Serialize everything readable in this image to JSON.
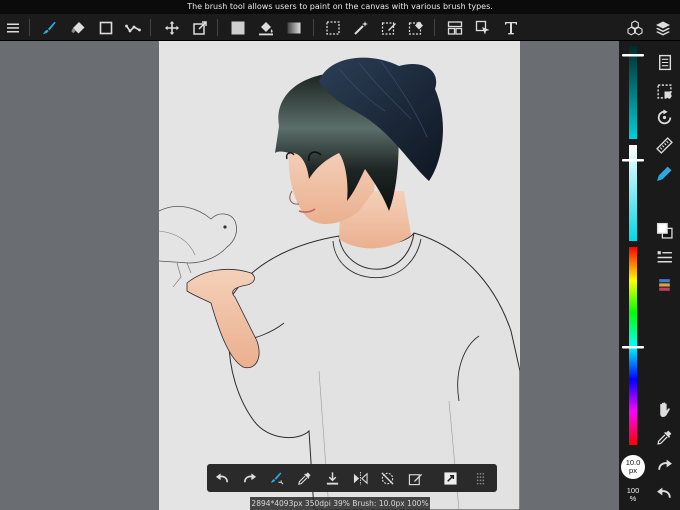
{
  "tooltip": "The brush tool allows users to paint on the canvas with various brush types.",
  "toolbar": {
    "items": [
      {
        "name": "menu-icon"
      },
      {
        "name": "brush-icon",
        "active": true
      },
      {
        "name": "eraser-icon"
      },
      {
        "name": "shape-icon"
      },
      {
        "name": "smudge-icon"
      },
      {
        "name": "move-icon"
      },
      {
        "name": "transform-icon"
      },
      {
        "name": "fill-color-icon"
      },
      {
        "name": "bucket-icon"
      },
      {
        "name": "gradient-icon"
      },
      {
        "name": "select-rect-icon"
      },
      {
        "name": "magic-wand-icon"
      },
      {
        "name": "select-pen-icon"
      },
      {
        "name": "select-eraser-icon"
      },
      {
        "name": "frame-divider-icon"
      },
      {
        "name": "selection-arrow-icon"
      },
      {
        "name": "text-icon"
      },
      {
        "name": "materials-icon"
      },
      {
        "name": "layers-icon"
      }
    ]
  },
  "right_tools": {
    "items": [
      {
        "name": "page-icon"
      },
      {
        "name": "select-dashed-icon"
      },
      {
        "name": "rotate-icon"
      },
      {
        "name": "ruler-icon"
      },
      {
        "name": "pen-active-icon",
        "active": true
      },
      {
        "name": "color-swap-icon"
      },
      {
        "name": "palette-list-icon"
      },
      {
        "name": "swatches-icon"
      },
      {
        "name": "hand-icon"
      },
      {
        "name": "eyedropper-icon"
      },
      {
        "name": "redo-icon"
      },
      {
        "name": "undo-icon"
      }
    ]
  },
  "brush_size": {
    "value": "10.0",
    "unit": "px"
  },
  "opacity": {
    "value": "100",
    "unit": "%"
  },
  "bottom_bar": {
    "items": [
      {
        "name": "undo-icon"
      },
      {
        "name": "redo-icon"
      },
      {
        "name": "brush-fill-icon"
      },
      {
        "name": "eyedropper-icon"
      },
      {
        "name": "download-icon"
      },
      {
        "name": "flip-icon"
      },
      {
        "name": "snap-off-icon"
      },
      {
        "name": "edit-icon"
      },
      {
        "name": "resize-icon"
      },
      {
        "name": "grid-dots-icon"
      }
    ]
  },
  "status": "2894*4093px 350dpi 39% Brush: 10.0px 100%",
  "colors": {
    "accent": "#2ea9e0",
    "toolbar_bg": "#1b1b1b",
    "workspace_bg": "#6a6d72",
    "canvas_bg": "#e4e4e4",
    "current_color": "#ffffff"
  }
}
